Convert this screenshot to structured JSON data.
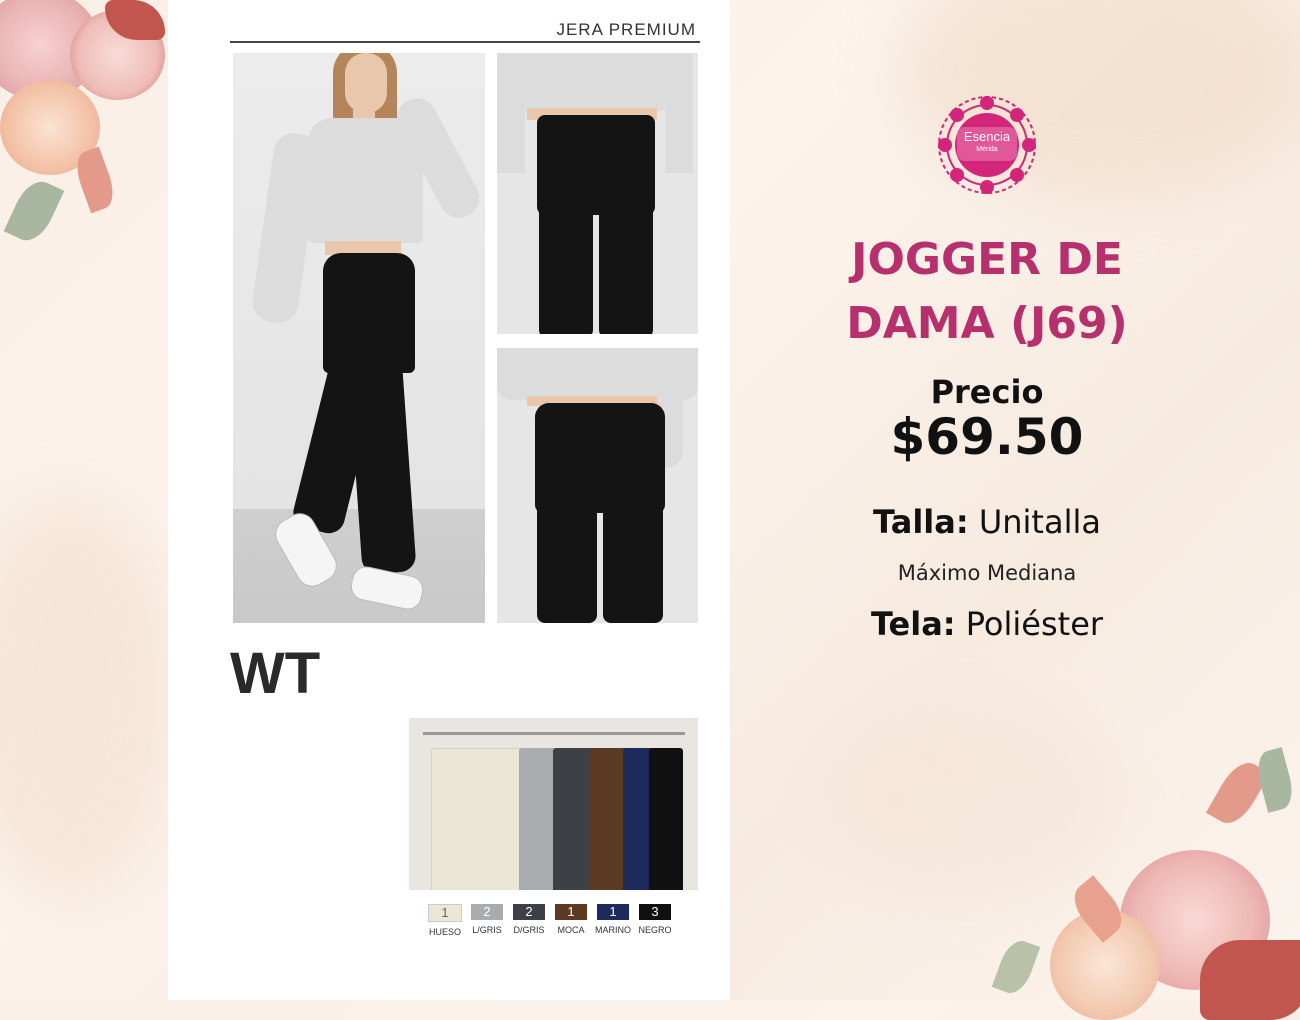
{
  "catalog": {
    "brand": "JERA PREMIUM",
    "code": "WT",
    "colors": [
      {
        "number": "1",
        "name": "HUESO",
        "hex": "#ece6d6"
      },
      {
        "number": "2",
        "name": "L/GRIS",
        "hex": "#a9acaf"
      },
      {
        "number": "2",
        "name": "D/GRIS",
        "hex": "#3d4045"
      },
      {
        "number": "1",
        "name": "MOCA",
        "hex": "#5b3a23"
      },
      {
        "number": "1",
        "name": "MARINO",
        "hex": "#1d2a5c"
      },
      {
        "number": "3",
        "name": "NEGRO",
        "hex": "#101010"
      }
    ]
  },
  "logo": {
    "name": "Esencia",
    "subtitle": "Mérida",
    "color": "#d3257a"
  },
  "product": {
    "title_line1": "JOGGER DE",
    "title_line2": "DAMA (J69)",
    "price_label": "Precio",
    "price": "$69.50",
    "size_label": "Talla:",
    "size_value": "Unitalla",
    "size_note": "Máximo Mediana",
    "fabric_label": "Tela:",
    "fabric_value": "Poliéster"
  },
  "colors": {
    "title": "#b5306d",
    "text": "#111111",
    "background": "#f9efe6"
  }
}
